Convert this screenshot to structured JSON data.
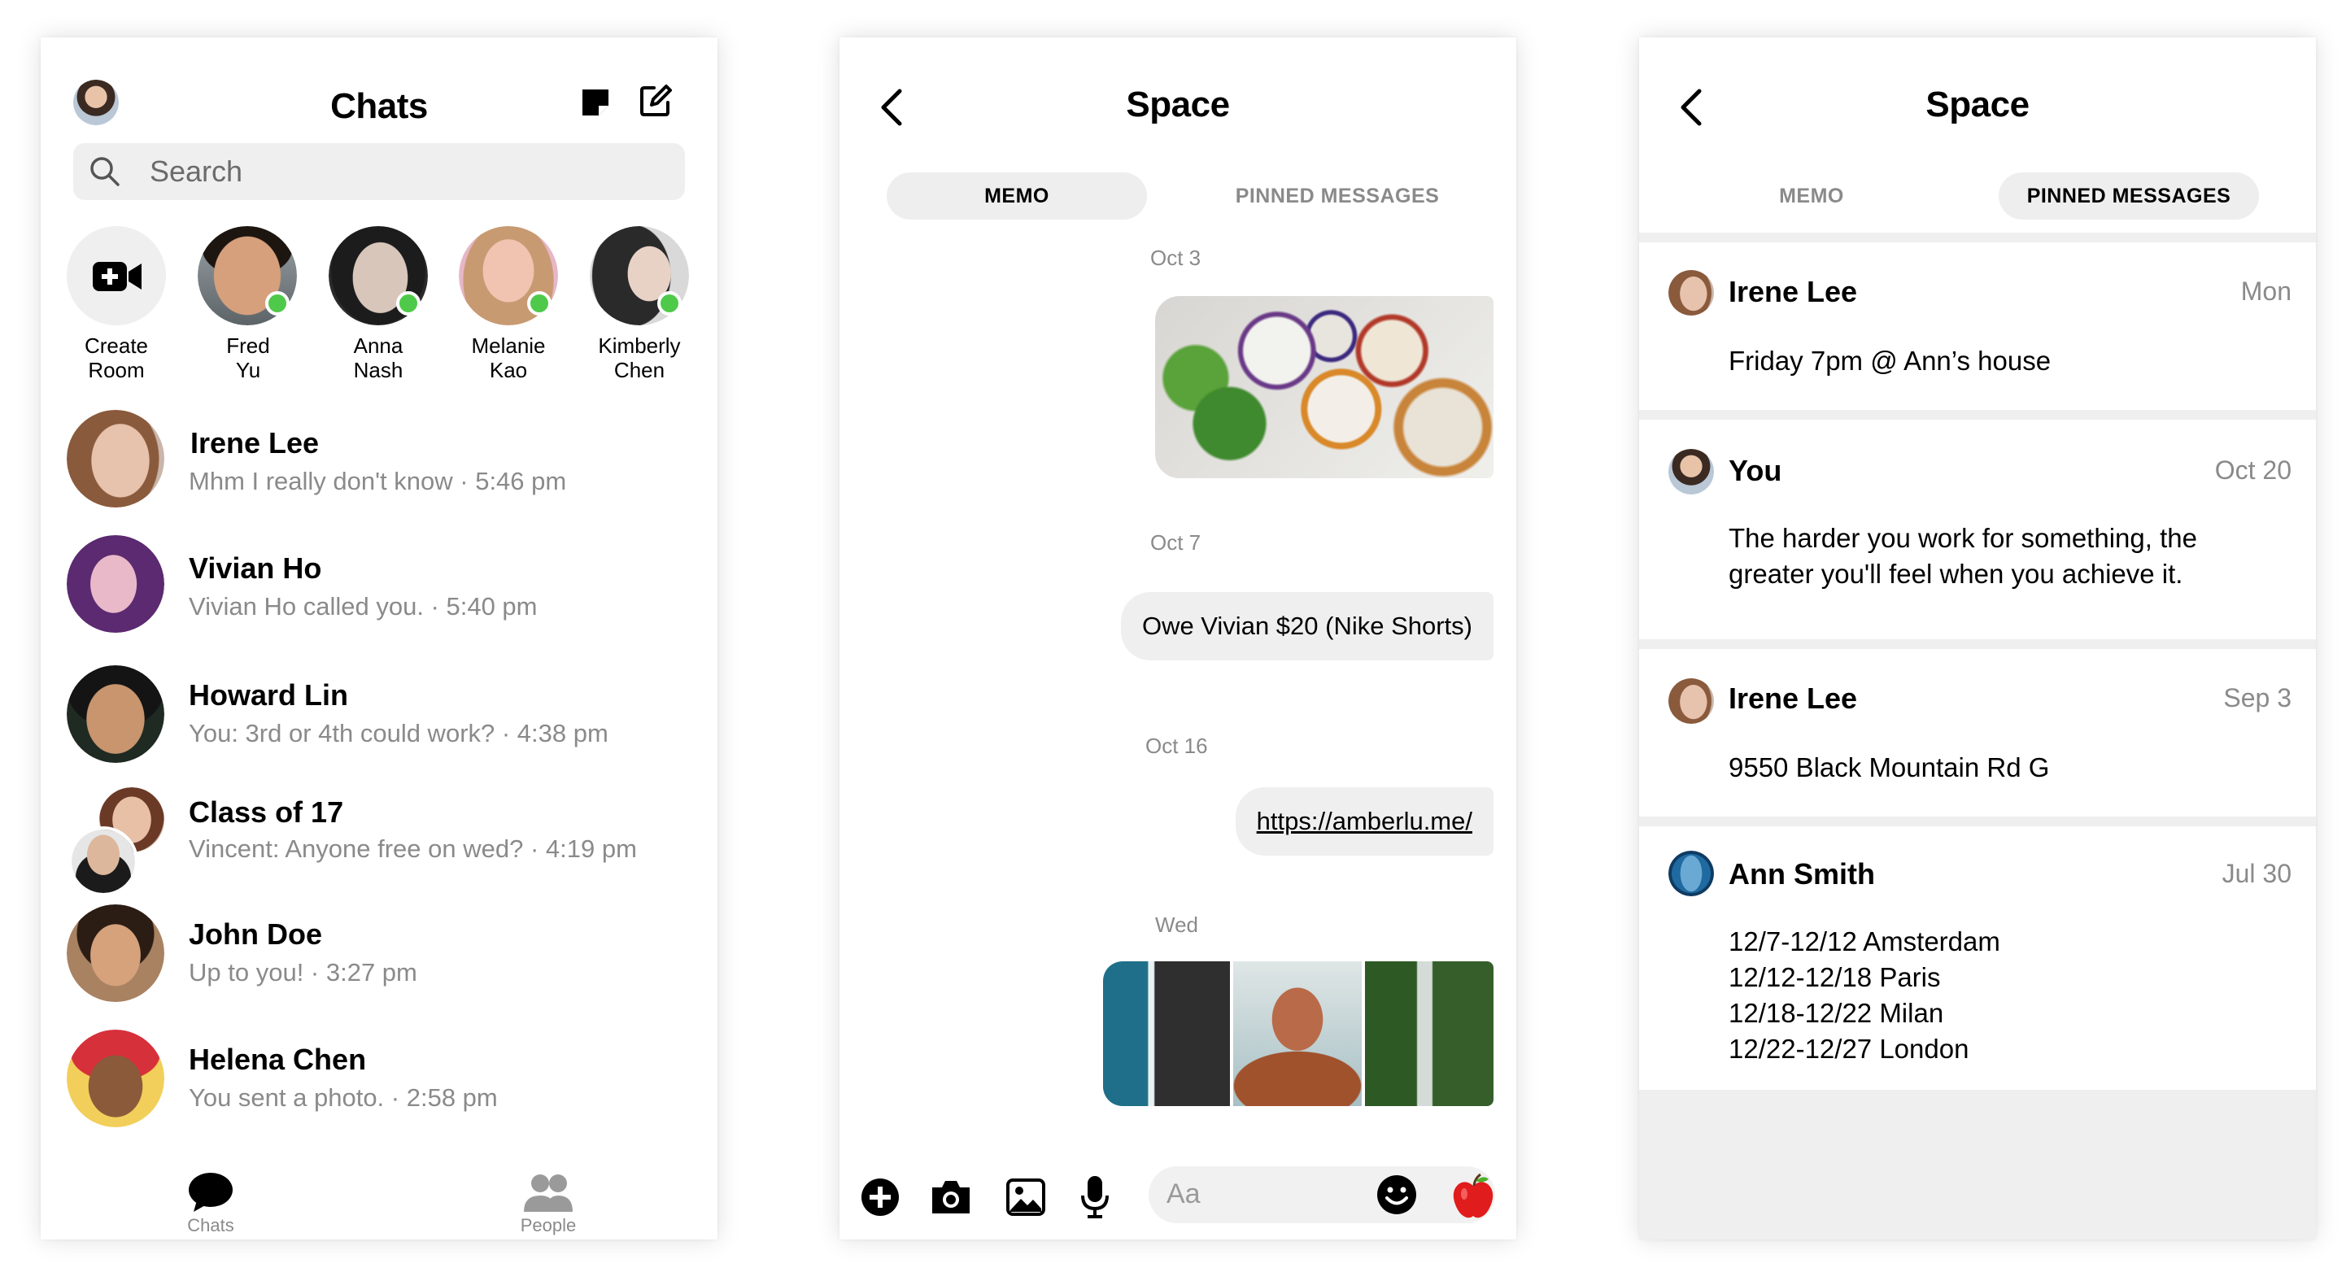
{
  "chats_screen": {
    "title": "Chats",
    "search_placeholder": "Search",
    "stories": [
      {
        "line1": "Create",
        "line2": "Room"
      },
      {
        "line1": "Fred",
        "line2": "Yu"
      },
      {
        "line1": "Anna",
        "line2": "Nash"
      },
      {
        "line1": "Melanie",
        "line2": "Kao"
      },
      {
        "line1": "Kimberly",
        "line2": "Chen"
      }
    ],
    "conversations": [
      {
        "name": "Irene Lee",
        "preview": "Mhm I really don't know · 5:46 pm"
      },
      {
        "name": "Vivian Ho",
        "preview": "Vivian Ho called you.  · 5:40 pm"
      },
      {
        "name": "Howard Lin",
        "preview": "You: 3rd or 4th could work?  · 4:38 pm"
      },
      {
        "name": "Class of 17",
        "preview": "Vincent: Anyone free on wed? · 4:19 pm"
      },
      {
        "name": "John Doe",
        "preview": "Up to you!  · 3:27 pm"
      },
      {
        "name": "Helena Chen",
        "preview": "You sent a photo.  · 2:58 pm"
      }
    ],
    "tabbar": {
      "chats": "Chats",
      "people": "People"
    }
  },
  "memo_screen": {
    "title": "Space",
    "tabs": {
      "memo": "MEMO",
      "pinned": "PINNED MESSAGES"
    },
    "dates": [
      "Oct 3",
      "Oct 7",
      "Oct 16",
      "Wed"
    ],
    "memo_text": "Owe Vivian $20 (Nike Shorts)",
    "memo_link": "https://amberlu.me/",
    "compose_placeholder": "Aa"
  },
  "pinned_screen": {
    "title": "Space",
    "tabs": {
      "memo": "MEMO",
      "pinned": "PINNED MESSAGES"
    },
    "items": [
      {
        "name": "Irene Lee",
        "date": "Mon",
        "lines": [
          "Friday 7pm @ Ann’s house"
        ]
      },
      {
        "name": "You",
        "date": "Oct 20",
        "lines": [
          "The harder you work for something, the",
          "greater you'll feel when you achieve it."
        ]
      },
      {
        "name": "Irene Lee",
        "date": "Sep 3",
        "lines": [
          "9550 Black Mountain Rd G"
        ]
      },
      {
        "name": "Ann Smith",
        "date": "Jul 30",
        "lines": [
          "12/7-12/12 Amsterdam",
          "12/12-12/18 Paris",
          "12/18-12/22 Milan",
          "12/22-12/27 London"
        ]
      }
    ]
  },
  "colors": {
    "online": "#4fc94a",
    "secondary_text": "#8a8a8a",
    "bubble": "#efefef",
    "segment_active": "#eeeeee"
  }
}
